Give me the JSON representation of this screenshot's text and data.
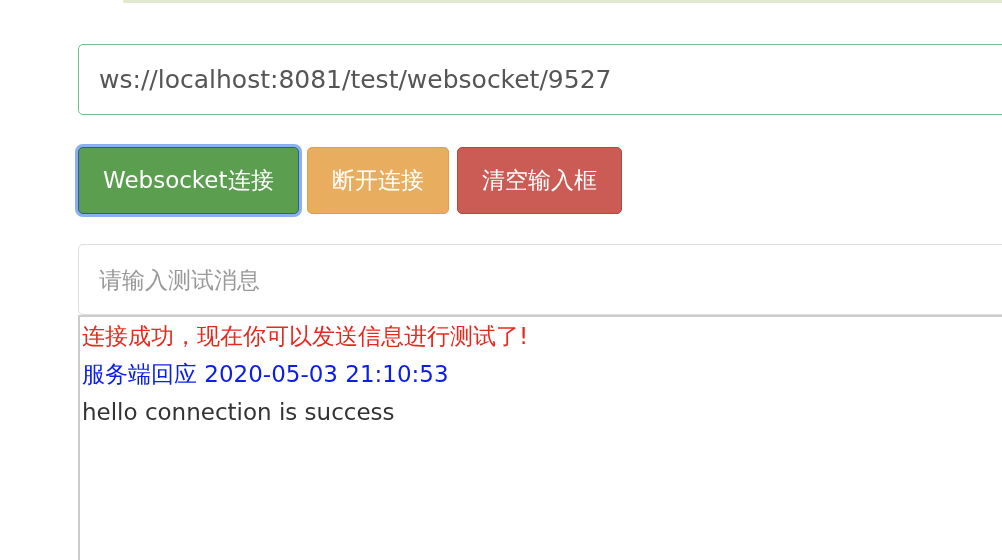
{
  "url_field": {
    "value": "ws://localhost:8081/test/websocket/9527"
  },
  "buttons": [
    {
      "label": "Websocket连接",
      "kind": "success",
      "focused": true
    },
    {
      "label": "断开连接",
      "kind": "warning",
      "focused": false
    },
    {
      "label": "清空输入框",
      "kind": "danger",
      "focused": false
    }
  ],
  "message_field": {
    "placeholder": "请输入测试消息"
  },
  "log": [
    {
      "text": "连接成功，现在你可以发送信息进行测试了!",
      "kind": "status"
    },
    {
      "text": "服务端回应 2020-05-03 21:10:53",
      "kind": "response"
    },
    {
      "text": "hello connection is success",
      "kind": "message"
    }
  ]
}
